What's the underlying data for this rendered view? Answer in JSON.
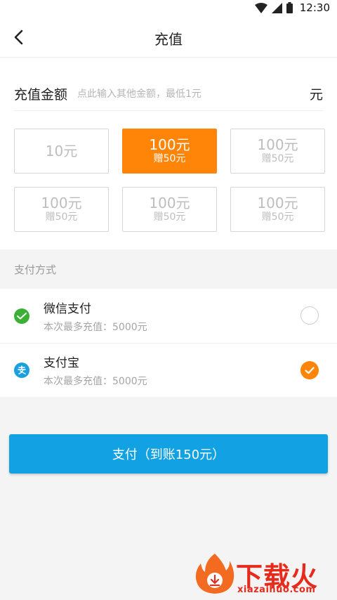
{
  "status_bar": {
    "time": "12:30"
  },
  "header": {
    "title": "充值"
  },
  "amount": {
    "label": "充值金额",
    "placeholder": "点此输入其他金额，最低1元",
    "unit": "元"
  },
  "options": [
    {
      "main": "10元",
      "sub": "",
      "selected": false
    },
    {
      "main": "100元",
      "sub": "赠50元",
      "selected": true
    },
    {
      "main": "100元",
      "sub": "赠50元",
      "selected": false
    },
    {
      "main": "100元",
      "sub": "赠50元",
      "selected": false
    },
    {
      "main": "100元",
      "sub": "赠50元",
      "selected": false
    },
    {
      "main": "100元",
      "sub": "赠50元",
      "selected": false
    }
  ],
  "payment": {
    "header": "支付方式",
    "methods": [
      {
        "name": "微信支付",
        "limit": "本次最多充值：5000元",
        "icon": "wechat-pay-icon",
        "selected": false
      },
      {
        "name": "支付宝",
        "limit": "本次最多充值：5000元",
        "icon": "alipay-icon",
        "selected": true
      }
    ]
  },
  "pay_button": {
    "label": "支付（到账150元）"
  },
  "watermark": {
    "brand": "下载火",
    "url": "xiazaihuo.com"
  },
  "colors": {
    "accent": "#ff8508",
    "primary": "#12a2e3",
    "wechat": "#3cb035",
    "alipay": "#1aa0e0"
  }
}
